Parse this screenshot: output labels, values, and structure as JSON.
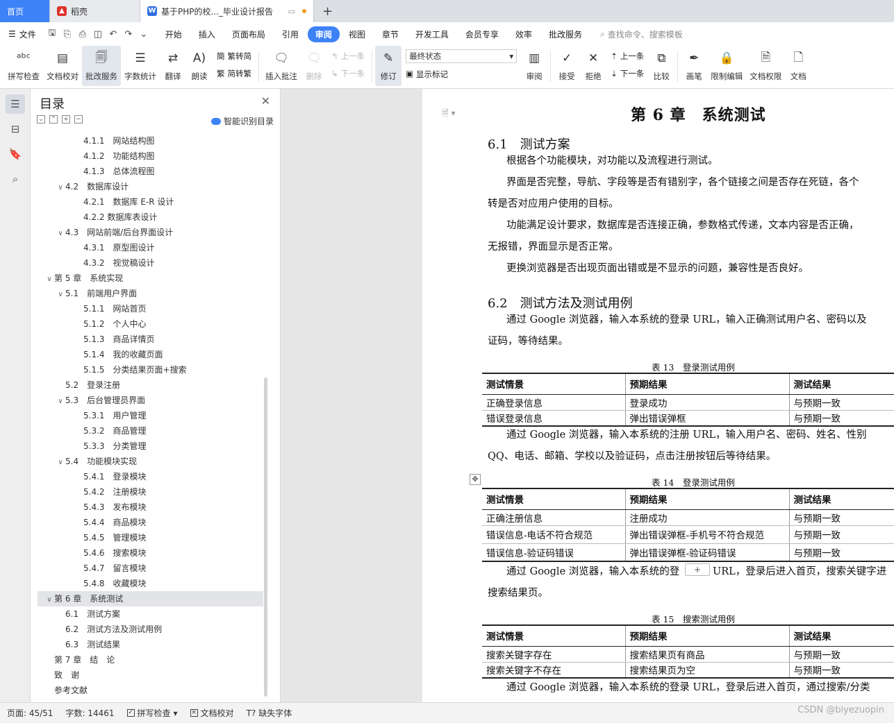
{
  "tabs": [
    {
      "label": "首页",
      "kind": "home"
    },
    {
      "label": "稻壳",
      "kind": "daoke"
    },
    {
      "label": "基于PHP的校..._毕业设计报告",
      "kind": "doc"
    }
  ],
  "menu": {
    "file_label": "文件",
    "tabs": [
      "开始",
      "插入",
      "页面布局",
      "引用",
      "审阅",
      "视图",
      "章节",
      "开发工具",
      "会员专享",
      "效率",
      "批改服务"
    ],
    "active_tab": "审阅",
    "search_placeholder": "查找命令、搜索模板"
  },
  "ribbon": {
    "spell": "拼写检查",
    "proof": "文档校对",
    "correct": "批改服务",
    "count": "字数统计",
    "translate": "翻译",
    "read": "朗读",
    "to_simplified": "繁转简",
    "to_traditional": "简转繁",
    "insert_comment": "插入批注",
    "delete": "删除",
    "prev": "上一条",
    "next": "下一条",
    "track": "修订",
    "final_state": "最终状态",
    "show_marks": "显示标记",
    "review": "审阅",
    "accept": "接受",
    "reject": "拒绝",
    "prev2": "上一条",
    "next2": "下一条",
    "compare": "比较",
    "pen": "画笔",
    "restrict": "限制编辑",
    "perm": "文档权限",
    "doc_more": "文档"
  },
  "toc": {
    "title": "目录",
    "smart": "智能识别目录",
    "items": [
      {
        "text": "4.1.1　网站结构图",
        "level": 3,
        "arrow": ""
      },
      {
        "text": "4.1.2　功能结构图",
        "level": 3,
        "arrow": ""
      },
      {
        "text": "4.1.3　总体流程图",
        "level": 3,
        "arrow": ""
      },
      {
        "text": "4.2　数据库设计",
        "level": 2,
        "arrow": "∨"
      },
      {
        "text": "4.2.1　数据库 E-R 设计",
        "level": 3,
        "arrow": ""
      },
      {
        "text": "4.2.2 数据库表设计",
        "level": 3,
        "arrow": ""
      },
      {
        "text": "4.3　网站前端/后台界面设计",
        "level": 2,
        "arrow": "∨"
      },
      {
        "text": "4.3.1　原型图设计",
        "level": 3,
        "arrow": ""
      },
      {
        "text": "4.3.2　视觉稿设计",
        "level": 3,
        "arrow": ""
      },
      {
        "text": "第 5 章　系统实现",
        "level": 1,
        "arrow": "∨"
      },
      {
        "text": "5.1　前端用户界面",
        "level": 2,
        "arrow": "∨"
      },
      {
        "text": "5.1.1　网站首页",
        "level": 3,
        "arrow": ""
      },
      {
        "text": "5.1.2　个人中心",
        "level": 3,
        "arrow": ""
      },
      {
        "text": "5.1.3　商品详情页",
        "level": 3,
        "arrow": ""
      },
      {
        "text": "5.1.4　我的收藏页面",
        "level": 3,
        "arrow": ""
      },
      {
        "text": "5.1.5　分类结果页面+搜索",
        "level": 3,
        "arrow": ""
      },
      {
        "text": "5.2　登录注册",
        "level": 2,
        "arrow": ""
      },
      {
        "text": "5.3　后台管理员界面",
        "level": 2,
        "arrow": "∨"
      },
      {
        "text": "5.3.1　用户管理",
        "level": 3,
        "arrow": ""
      },
      {
        "text": "5.3.2　商品管理",
        "level": 3,
        "arrow": ""
      },
      {
        "text": "5.3.3　分类管理",
        "level": 3,
        "arrow": ""
      },
      {
        "text": "5.4　功能模块实现",
        "level": 2,
        "arrow": "∨"
      },
      {
        "text": "5.4.1　登录模块",
        "level": 3,
        "arrow": ""
      },
      {
        "text": "5.4.2　注册模块",
        "level": 3,
        "arrow": ""
      },
      {
        "text": "5.4.3　发布模块",
        "level": 3,
        "arrow": ""
      },
      {
        "text": "5.4.4　商品模块",
        "level": 3,
        "arrow": ""
      },
      {
        "text": "5.4.5　管理模块",
        "level": 3,
        "arrow": ""
      },
      {
        "text": "5.4.6　搜索模块",
        "level": 3,
        "arrow": ""
      },
      {
        "text": "5.4.7　留言模块",
        "level": 3,
        "arrow": ""
      },
      {
        "text": "5.4.8　收藏模块",
        "level": 3,
        "arrow": ""
      },
      {
        "text": "第 6 章　系统测试",
        "level": 1,
        "arrow": "∨",
        "selected": true
      },
      {
        "text": "6.1　测试方案",
        "level": 2,
        "arrow": ""
      },
      {
        "text": "6.2　测试方法及测试用例",
        "level": 2,
        "arrow": ""
      },
      {
        "text": "6.3　测试结果",
        "level": 2,
        "arrow": ""
      },
      {
        "text": "第 7 章　结　论",
        "level": 1,
        "arrow": ""
      },
      {
        "text": "致　谢",
        "level": 1,
        "arrow": ""
      },
      {
        "text": "参考文献",
        "level": 1,
        "arrow": ""
      }
    ]
  },
  "doc": {
    "chapter": "第 6 章　系统测试",
    "s61": "6.1　测试方案",
    "p1": "根据各个功能模块，对功能以及流程进行测试。",
    "p2a": "界面是否完整，导航、字段等是否有错别字，各个链接之间是否存在死链，各个",
    "p2b": "转是否对应用户使用的目标。",
    "p3a": "功能满足设计要求，数据库是否连接正确，参数格式传递，文本内容是否正确，",
    "p3b": "无报错，界面显示是否正常。",
    "p4": "更换浏览器是否出现页面出错或是不显示的问题，兼容性是否良好。",
    "s62": "6.2　测试方法及测试用例",
    "p5a": "通过 Google 浏览器，输入本系统的登录 URL，输入正确测试用户名、密码以及",
    "p5b": "证码，等待结果。",
    "t13_caption": "表 13　登录测试用例",
    "headers": [
      "测试情景",
      "预期结果",
      "测试结果"
    ],
    "t13_rows": [
      [
        "正确登录信息",
        "登录成功",
        "与预期一致"
      ],
      [
        "错误登录信息",
        "弹出错误弹框",
        "与预期一致"
      ]
    ],
    "p6a": "通过 Google 浏览器，输入本系统的注册 URL，输入用户名、密码、姓名、性别",
    "p6b": "QQ、电话、邮箱、学校以及验证码，点击注册按钮后等待结果。",
    "t14_caption": "表 14　登录测试用例",
    "t14_rows": [
      [
        "正确注册信息",
        "注册成功",
        "与预期一致"
      ],
      [
        "错误信息-电话不符合规范",
        "弹出错误弹框-手机号不符合规范",
        "与预期一致"
      ],
      [
        "错误信息-验证码错误",
        "弹出错误弹框-验证码错误",
        "与预期一致"
      ]
    ],
    "p7a_left": "通过 Google 浏览器，输入本系统的登",
    "p7a_right": "URL，登录后进入首页，搜索关键字进",
    "p7b": "搜索结果页。",
    "t15_caption": "表 15　搜索测试用例",
    "t15_rows": [
      [
        "搜索关键字存在",
        "搜索结果页有商品",
        "与预期一致"
      ],
      [
        "搜索关键字不存在",
        "搜索结果页为空",
        "与预期一致"
      ]
    ],
    "p8": "通过 Google 浏览器，输入本系统的登录 URL，登录后进入首页，通过搜索/分类"
  },
  "status": {
    "page": "页面: 45/51",
    "words": "字数: 14461",
    "spell": "拼写检查",
    "proof": "文档校对",
    "font": "缺失字体"
  },
  "watermark": "CSDN @biyezuopin",
  "colors": {
    "accent": "#3e82f7",
    "daoke": "#e0302a",
    "doc_icon": "#2f6fe0"
  }
}
